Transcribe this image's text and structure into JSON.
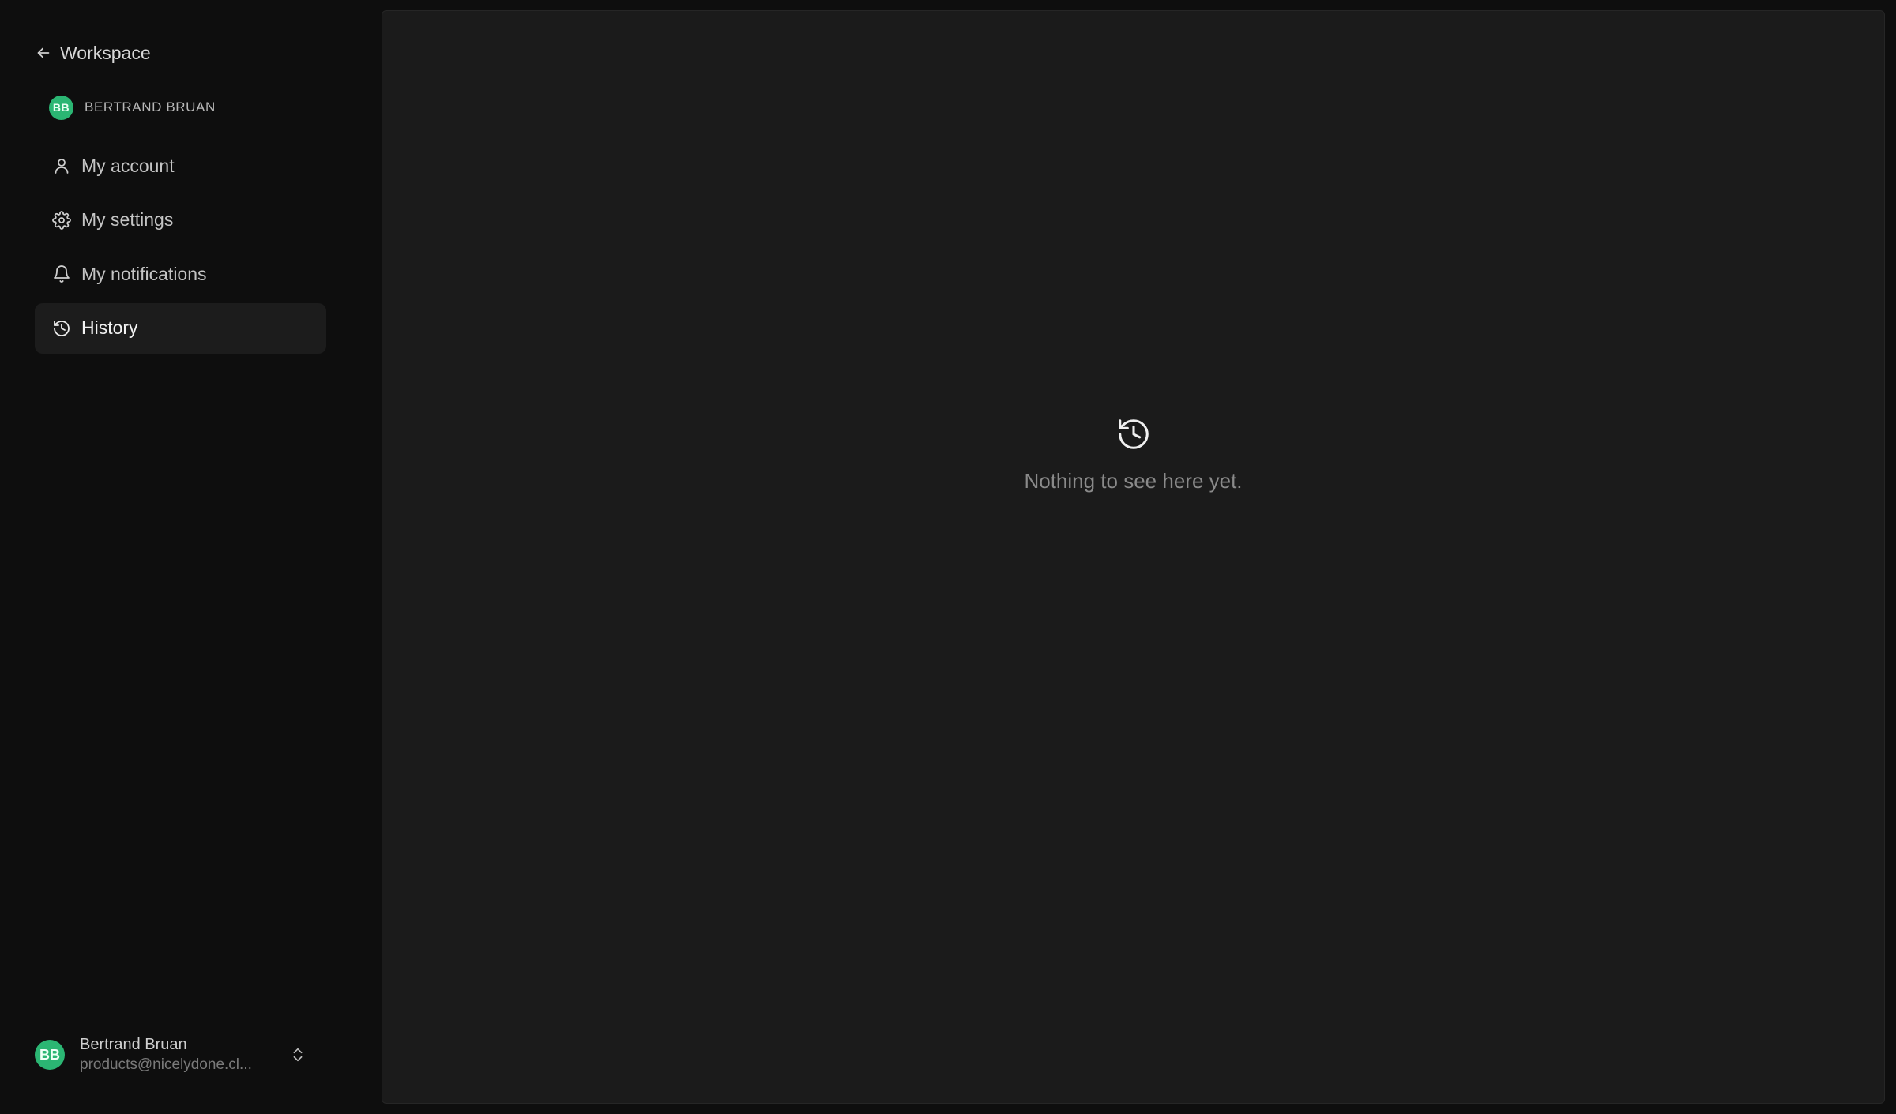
{
  "sidebar": {
    "back_label": "Workspace",
    "owner": {
      "initials": "BB",
      "name": "BERTRAND BRUAN"
    },
    "items": [
      {
        "label": "My account",
        "icon": "user-icon",
        "active": false
      },
      {
        "label": "My settings",
        "icon": "gear-icon",
        "active": false
      },
      {
        "label": "My notifications",
        "icon": "bell-icon",
        "active": false
      },
      {
        "label": "History",
        "icon": "history-icon",
        "active": true
      }
    ],
    "user": {
      "initials": "BB",
      "name": "Bertrand Bruan",
      "email": "products@nicelydone.cl..."
    }
  },
  "main": {
    "empty_icon": "history-icon",
    "empty_text": "Nothing to see here yet."
  },
  "colors": {
    "avatar": "#2bb673",
    "background": "#0e0e0e",
    "panel": "#1b1b1b",
    "active_item": "#1c1c1c"
  }
}
